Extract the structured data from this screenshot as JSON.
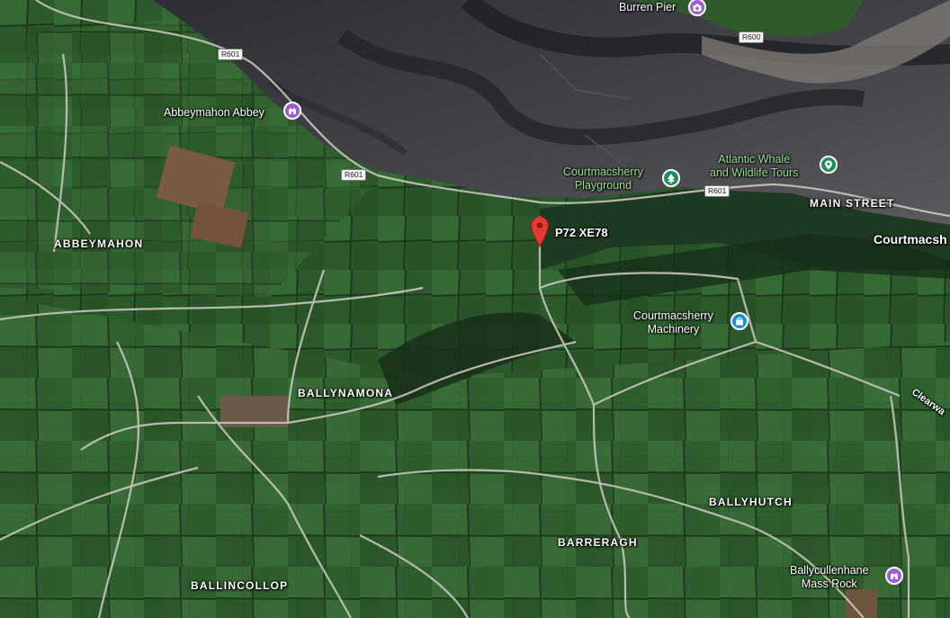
{
  "map": {
    "type": "satellite",
    "colors": {
      "sea": "#3b3d44",
      "fields": "#2f5a2e",
      "road": "#c9c6bd",
      "pin": "#e53935"
    }
  },
  "areas": {
    "abbeymahon": "ABBEYMAHON",
    "ballynamona": "BALLYNAMONA",
    "ballincollop": "BALLINCOLLOP",
    "barreragh": "BARRERAGH",
    "ballyhutch": "BALLYHUTCH",
    "main_street": "MAIN STREET"
  },
  "town": "Courtmacsh",
  "pois": {
    "burren_pier": "Burren Pier",
    "abbeymahon_abbey": "Abbeymahon Abbey",
    "playground_line1": "Courtmacsherry",
    "playground_line2": "Playground",
    "whale_line1": "Atlantic Whale",
    "whale_line2": "and Wildlife Tours",
    "machinery_line1": "Courtmacsherry",
    "machinery_line2": "Machinery",
    "mass_line1": "Ballycullenhane",
    "mass_line2": "Mass Rock"
  },
  "roads": {
    "r601_a": "R601",
    "r601_b": "R601",
    "r601_c": "R601",
    "r600": "R600",
    "clearwater": "Clearwa"
  },
  "pin": {
    "label": "P72 XE78"
  },
  "icons": {
    "burren_pier": "camera-icon",
    "abbey": "monument-icon",
    "playground": "tree-icon",
    "whale": "pin-tour-icon",
    "machinery": "shopping-bag-icon",
    "mass_rock": "monument-icon",
    "pin": "location-pin-icon"
  }
}
